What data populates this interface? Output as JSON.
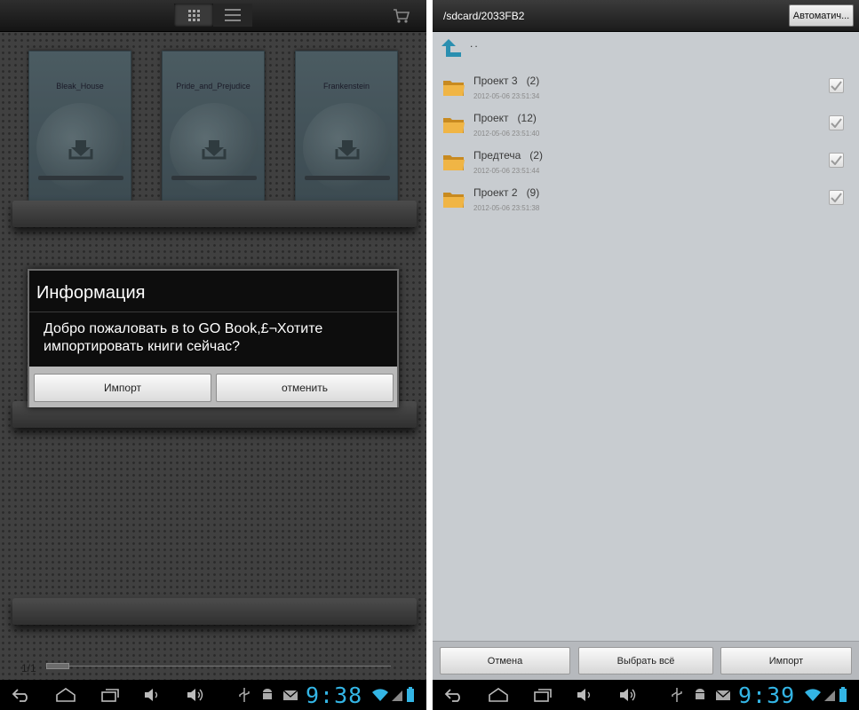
{
  "left": {
    "books": [
      {
        "title": "Bleak_House"
      },
      {
        "title": "Pride_and_Prejudice"
      },
      {
        "title": "Frankenstein"
      }
    ],
    "dialog": {
      "title": "Информация",
      "message": "Добро пожаловать в to GO Book,£¬Хотите импортировать книги сейчас?",
      "confirm_label": "Импорт",
      "cancel_label": "отменить"
    },
    "pager": {
      "label": "1/1"
    },
    "status": {
      "time": "9:38"
    }
  },
  "right": {
    "header": {
      "path": "/sdcard/2033FB2",
      "auto_button_label": "Автоматич..."
    },
    "up_label": "..",
    "files": [
      {
        "name": "Проект 3",
        "count": "(2)",
        "date": "2012-05-06 23:51:34",
        "checked": true
      },
      {
        "name": "Проект",
        "count": "(12)",
        "date": "2012-05-06 23:51:40",
        "checked": true
      },
      {
        "name": "Предтеча",
        "count": "(2)",
        "date": "2012-05-06 23:51:44",
        "checked": true
      },
      {
        "name": "Проект 2",
        "count": "(9)",
        "date": "2012-05-06 23:51:38",
        "checked": true
      }
    ],
    "footer": {
      "cancel_label": "Отмена",
      "select_all_label": "Выбрать всё",
      "import_label": "Импорт"
    },
    "status": {
      "time": "9:39"
    }
  },
  "colors": {
    "clock": "#33b5e5",
    "dialog_bg": "#0d0d0d",
    "list_bg": "#c8ccd0",
    "folder": "#e8a83a",
    "up_arrow": "#2a8fb0"
  },
  "icons": [
    "grid-view-icon",
    "list-view-icon",
    "cart-icon",
    "download-icon",
    "up-folder-icon",
    "folder-icon",
    "check-icon",
    "back-icon",
    "home-icon",
    "recent-apps-icon",
    "volume-down-icon",
    "volume-up-icon",
    "usb-icon",
    "android-debug-icon",
    "email-icon",
    "wifi-icon",
    "signal-icon",
    "battery-icon"
  ]
}
